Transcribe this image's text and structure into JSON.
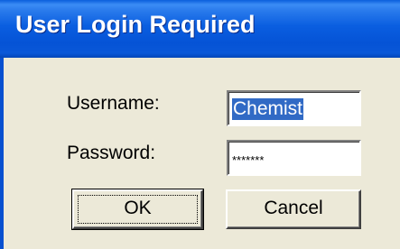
{
  "window": {
    "title": "User Login Required"
  },
  "form": {
    "username_label": "Username:",
    "username_value": "Chemist",
    "password_label": "Password:",
    "password_masked": "*******"
  },
  "buttons": {
    "ok_label": "OK",
    "cancel_label": "Cancel"
  },
  "colors": {
    "titlebar": "#0a5ee0",
    "dialog_bg": "#ece9d8",
    "selection": "#316ac5"
  }
}
